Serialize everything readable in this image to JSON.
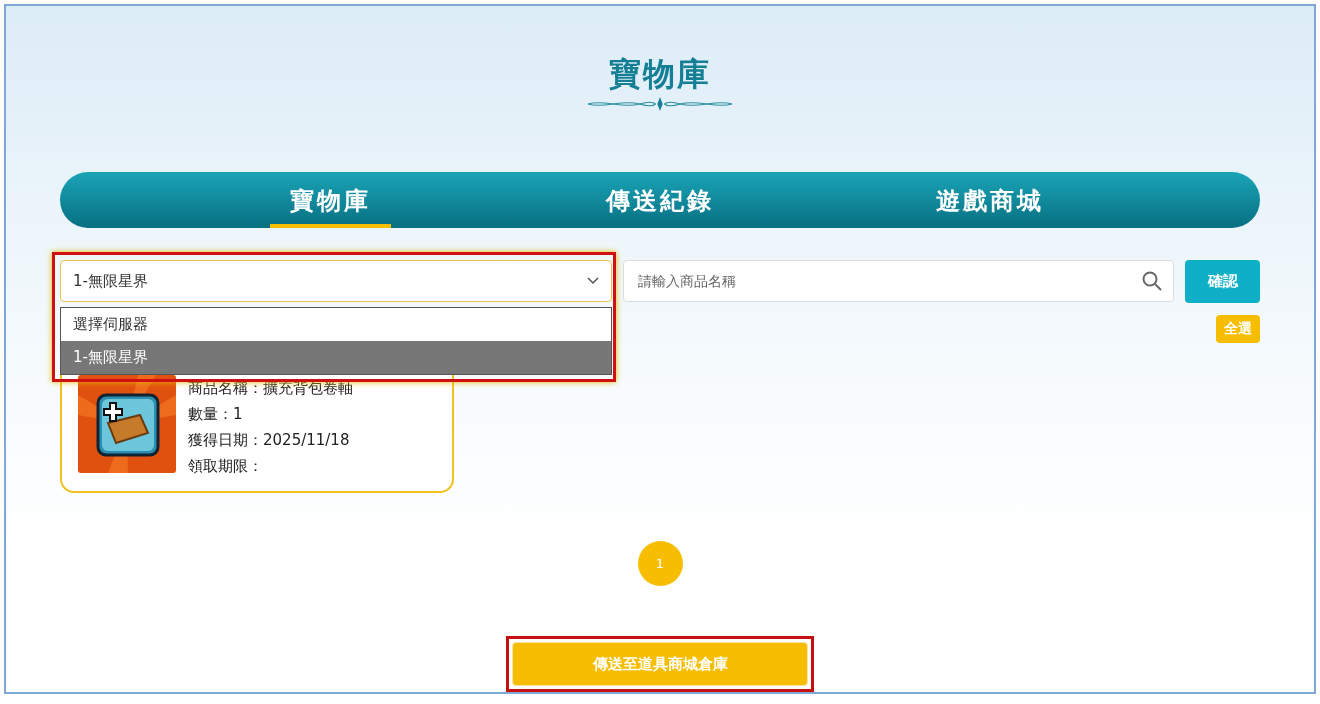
{
  "title": "寶物庫",
  "tabs": [
    {
      "label": "寶物庫",
      "selected": true
    },
    {
      "label": "傳送紀錄",
      "selected": false
    },
    {
      "label": "遊戲商城",
      "selected": false
    }
  ],
  "server_select": {
    "value": "1-無限星界",
    "expanded": true,
    "highlighted": true,
    "options": [
      {
        "label": "選擇伺服器",
        "selected": false
      },
      {
        "label": "1-無限星界",
        "selected": true
      }
    ]
  },
  "search": {
    "placeholder": "請輸入商品名稱"
  },
  "confirm_button": "確認",
  "select_all_button": "全選",
  "items": [
    {
      "lines": [
        "商品名稱：擴充背包卷軸",
        "數量：1",
        "獲得日期：2025/11/18",
        "領取期限："
      ]
    }
  ],
  "pagination": [
    {
      "label": "1",
      "selected": true
    }
  ],
  "send_button": {
    "label": "傳送至道具商城倉庫",
    "highlighted": true
  }
}
